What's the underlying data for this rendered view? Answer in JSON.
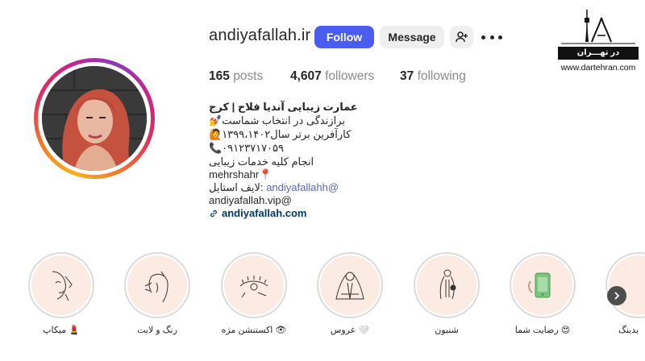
{
  "profile": {
    "username": "andiyafallah.ir",
    "follow_label": "Follow",
    "message_label": "Message",
    "posts_count": "165",
    "posts_label": "posts",
    "followers_count": "4,607",
    "followers_label": "followers",
    "following_count": "37",
    "following_label": "following"
  },
  "bio": {
    "name": "عمارت زیبایی آندیا فلاح | کرج",
    "line1": "💅برازندگی در انتخاب شماست",
    "line2": "🙋کارآفرین برتر سال۱۳۹۹،۱۴۰۲",
    "line3": "📞۰۹۱۲۳۷۱۷۰۵۹",
    "line4": "انجام کلیه خدمات زیبایی",
    "line5": "mehrshahr📍",
    "line6_prefix": "لایف استایل: ",
    "line6_mention": "andiyafallahh@",
    "line7": "andiyafallah.vip@",
    "website": "andiyafallah.com"
  },
  "highlights": [
    {
      "label": "میکاپ 💄",
      "icon": "makeup-face-icon"
    },
    {
      "label": "رنگ و لایت",
      "icon": "hair-color-icon"
    },
    {
      "label": "اکستنشن مژه 👁",
      "icon": "eyelash-extension-icon"
    },
    {
      "label": "عروس 🤍",
      "icon": "bride-veil-icon"
    },
    {
      "label": "شنیون",
      "icon": "hairstyle-icon"
    },
    {
      "label": "رضایت شما 😍",
      "icon": "phone-review-icon"
    },
    {
      "label": "بدینگ",
      "icon": "partial-highlight-icon"
    }
  ],
  "watermark": {
    "band_text": "در تهـــران",
    "url": "www.dartehran.com"
  },
  "colors": {
    "follow_button": "#4a5df0",
    "link": "#00376b",
    "highlight_bg": "#fbebe2"
  }
}
